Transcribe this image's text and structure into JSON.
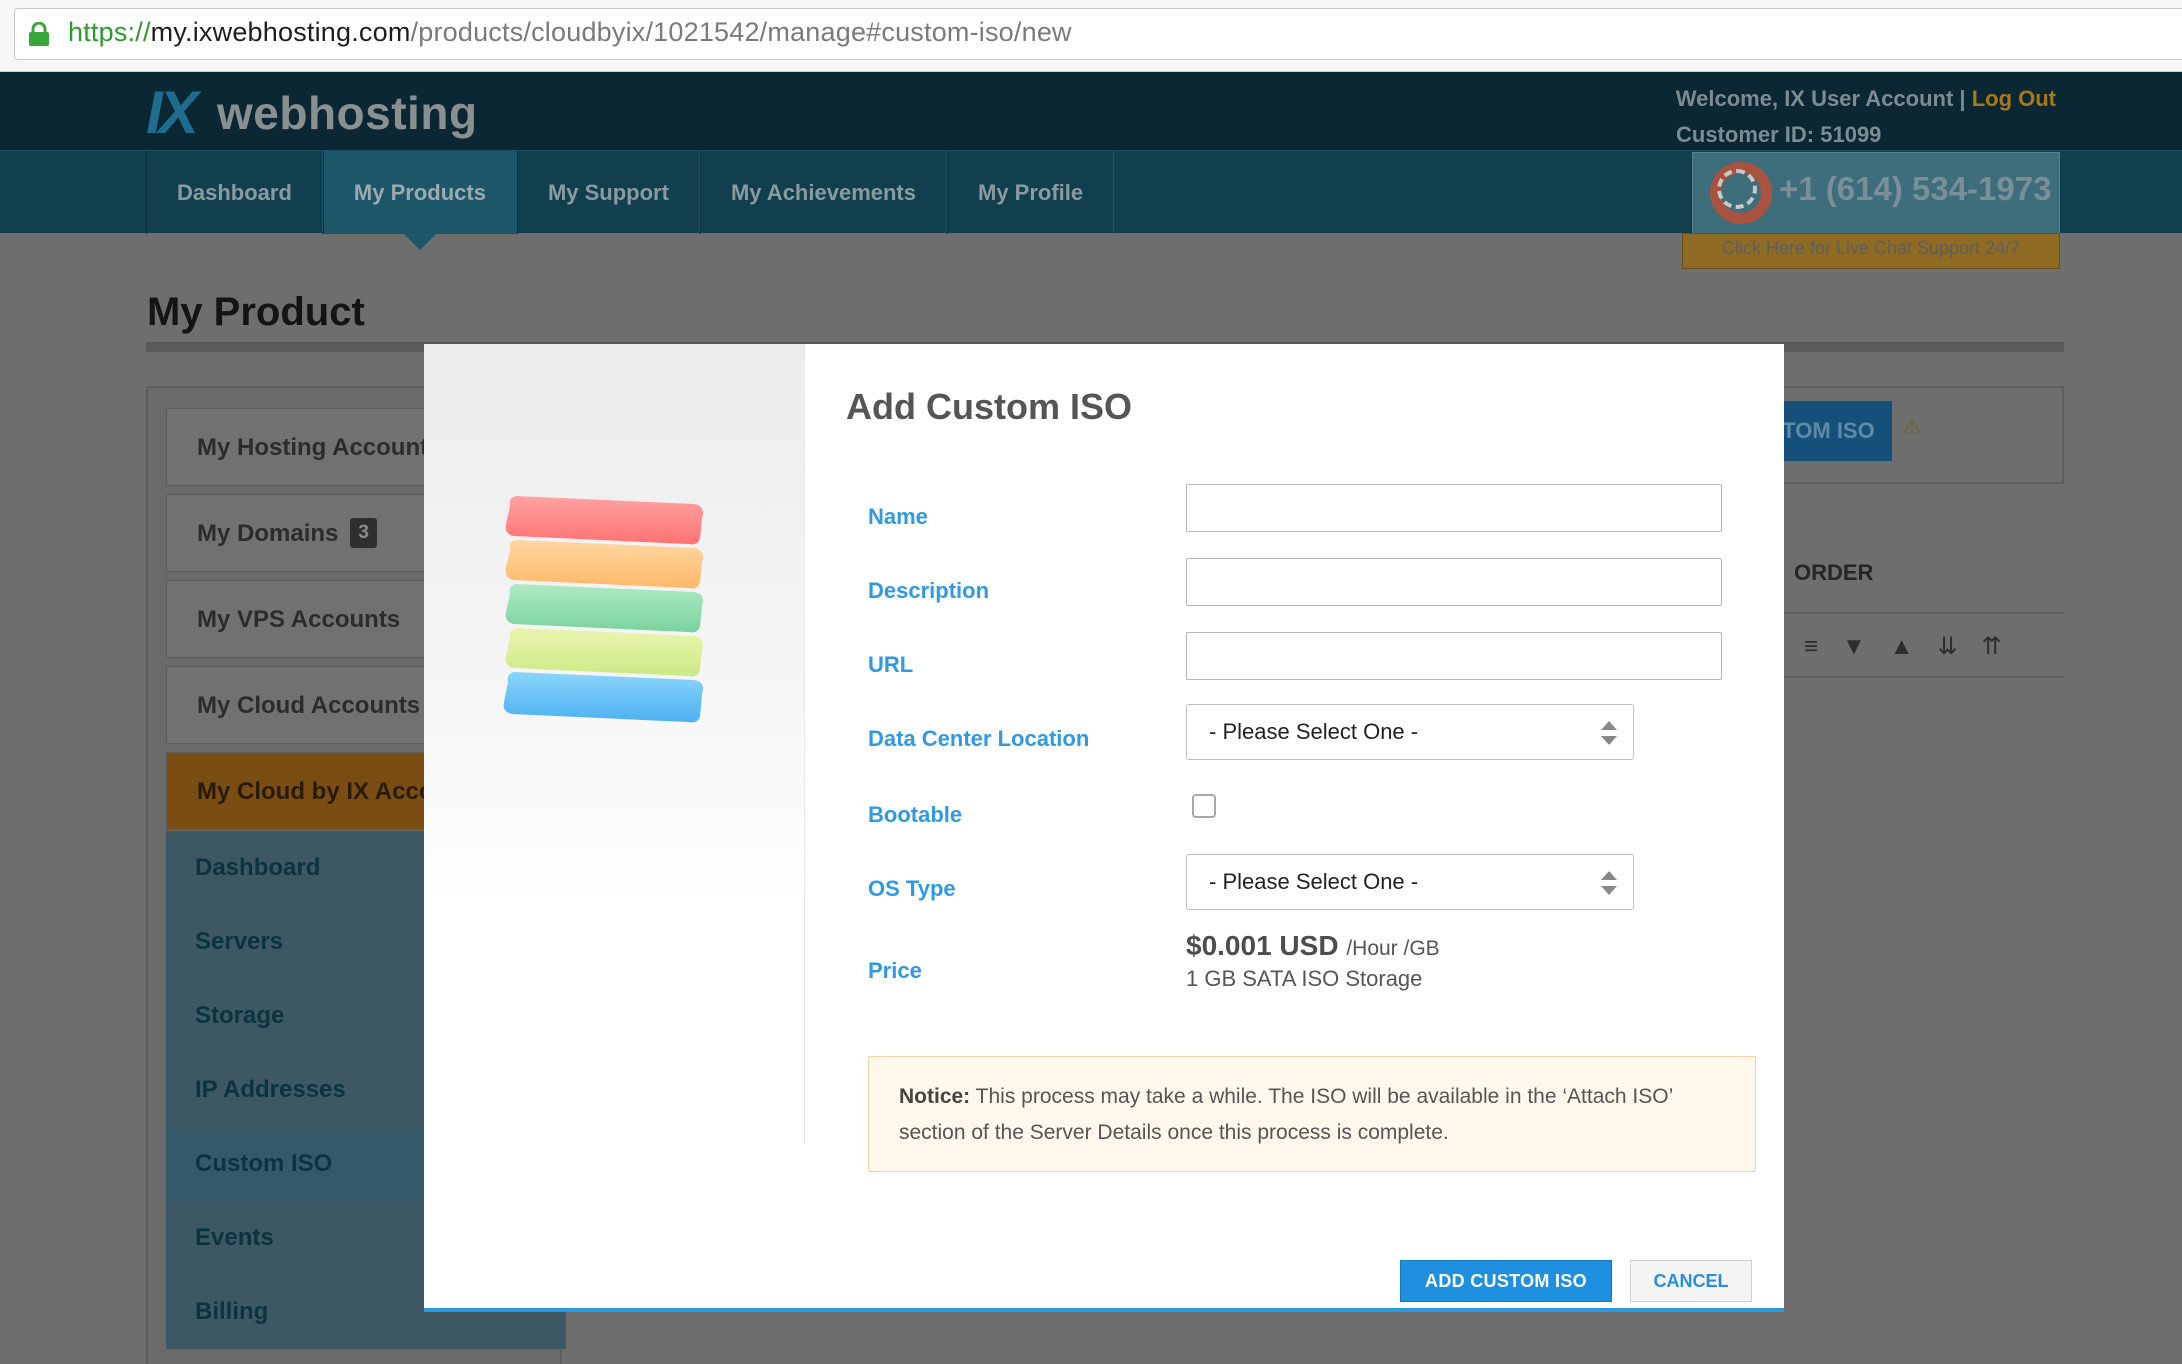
{
  "browser": {
    "url_scheme": "https://",
    "url_host": "my.ixwebhosting.com",
    "url_path": "/products/cloudbyix/1021542/manage#custom-iso/new"
  },
  "header": {
    "logo_mark": "IX",
    "logo_text": "webhosting",
    "welcome": "Welcome, IX User Account | ",
    "logout": "Log Out",
    "customer_id": "Customer ID: 51099",
    "phone": "+1 (614) 534-1973",
    "chat": "Click Here for Live Chat Support 24/7"
  },
  "nav": {
    "items": [
      {
        "label": "Dashboard"
      },
      {
        "label": "My Products"
      },
      {
        "label": "My Support"
      },
      {
        "label": "My Achievements"
      },
      {
        "label": "My Profile"
      }
    ],
    "active": "My Products"
  },
  "page": {
    "title": "My Product",
    "bg_button": "ADD CUSTOM ISO",
    "order_label": "ORDER"
  },
  "sidebar": {
    "items": [
      {
        "label": "My Hosting Accounts"
      },
      {
        "label": "My Domains",
        "badge": "3"
      },
      {
        "label": "My VPS Accounts"
      },
      {
        "label": "My Cloud Accounts"
      },
      {
        "label": "My Cloud by IX Accounts"
      }
    ],
    "sub_items": [
      {
        "label": "Dashboard"
      },
      {
        "label": "Servers"
      },
      {
        "label": "Storage"
      },
      {
        "label": "IP Addresses"
      },
      {
        "label": "Custom ISO"
      },
      {
        "label": "Events"
      },
      {
        "label": "Billing"
      }
    ],
    "active_sub": "Custom ISO"
  },
  "modal": {
    "title": "Add Custom ISO",
    "fields": {
      "name": {
        "label": "Name",
        "value": ""
      },
      "description": {
        "label": "Description",
        "value": ""
      },
      "url": {
        "label": "URL",
        "value": ""
      },
      "datacenter": {
        "label": "Data Center Location",
        "value": "- Please Select One -"
      },
      "bootable": {
        "label": "Bootable",
        "checked": false
      },
      "os_type": {
        "label": "OS Type",
        "value": "- Please Select One -"
      },
      "price": {
        "label": "Price",
        "amount": "$0.001 USD",
        "unit": "/Hour /GB",
        "detail": "1 GB SATA ISO Storage"
      }
    },
    "notice_bold": "Notice:",
    "notice_text": "This process may take a while. The ISO will be available in the ‘Attach ISO’ section of the Server Details once this process is complete.",
    "buttons": {
      "submit": "Add Custom ISO",
      "cancel": "Cancel"
    }
  },
  "colors": {
    "accent_blue": "#2f9ae2",
    "button_blue": "#1f8fe0",
    "notice_bg": "#fdf8eb",
    "header_dark": "#0b2733",
    "logout_orange": "#a8781a"
  }
}
